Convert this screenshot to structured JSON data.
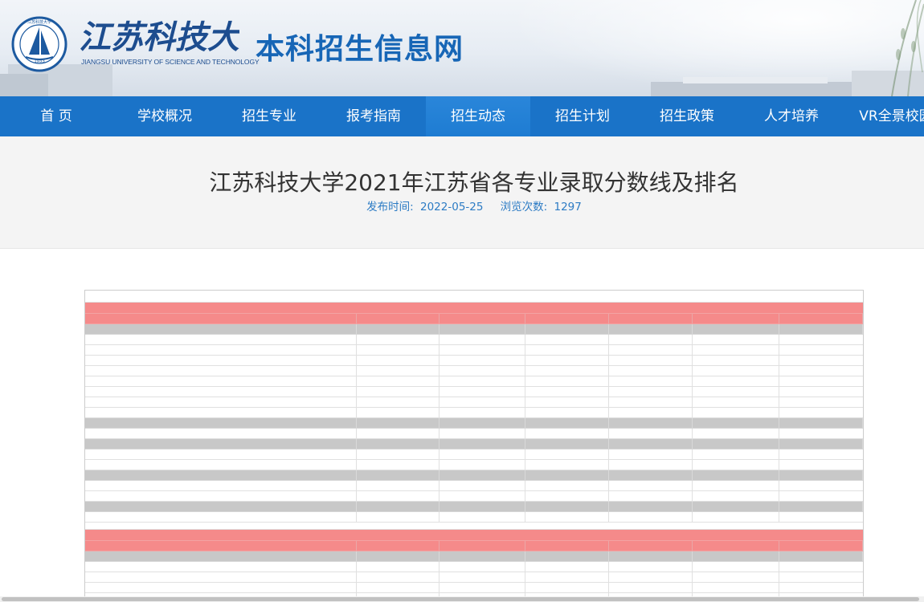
{
  "brand": {
    "name_cn": "江苏科技大学",
    "name_en": "JIANGSU UNIVERSITY OF SCIENCE AND TECHNOLOGY",
    "seal_year": "1933",
    "site_title": "本科招生信息网",
    "colors": {
      "title_blue": "#1766b6",
      "nav_blue": "#1a73c8",
      "band_pink": "#f58a8a",
      "group_gray": "#c8c8c8"
    }
  },
  "nav": {
    "items": [
      {
        "label": "首 页",
        "active": false
      },
      {
        "label": "学校概况",
        "active": false
      },
      {
        "label": "招生专业",
        "active": false
      },
      {
        "label": "报考指南",
        "active": false
      },
      {
        "label": "招生动态",
        "active": true
      },
      {
        "label": "招生计划",
        "active": false
      },
      {
        "label": "招生政策",
        "active": false
      },
      {
        "label": "人才培养",
        "active": false
      },
      {
        "label": "VR全景校园",
        "active": false
      }
    ]
  },
  "article": {
    "title": "江苏科技大学2021年江苏省各专业录取分数线及排名",
    "publish_label": "发布时间:",
    "publish_date": "2022-05-25",
    "views_label": "浏览次数:",
    "views": "1297"
  }
}
